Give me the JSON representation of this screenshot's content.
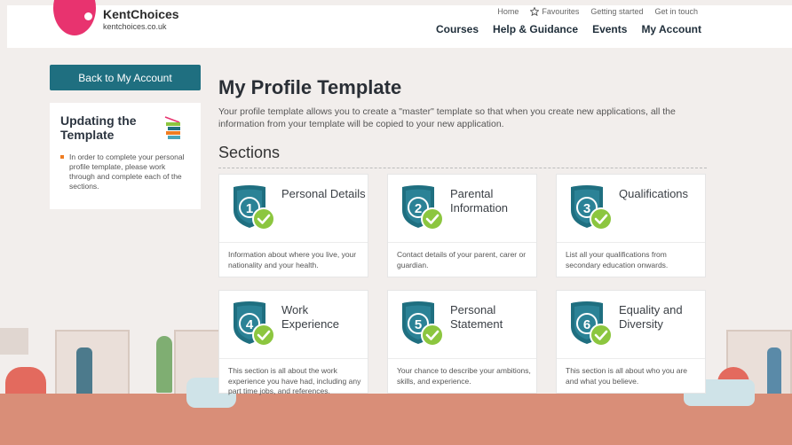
{
  "header": {
    "logo_name": "KentChoices",
    "logo_url": "kentchoices.co.uk",
    "top_links": [
      "Home",
      "Favourites",
      "Getting started",
      "Get in touch"
    ],
    "main_nav": [
      "Courses",
      "Help & Guidance",
      "Events",
      "My Account"
    ]
  },
  "sidebar": {
    "back_label": "Back to My Account",
    "card_title": "Updating the Template",
    "card_text": "In order to complete your personal profile template, please work through and complete each of the sections."
  },
  "main": {
    "title": "My Profile Template",
    "intro": "Your profile template allows you to create a \"master\" template so that when you create new applications, all the information from your template will be copied to your new application.",
    "sections_heading": "Sections"
  },
  "sections": [
    {
      "number": "1",
      "title": "Personal Details",
      "description": "Information about where you live, your nationality and your health."
    },
    {
      "number": "2",
      "title": "Parental Information",
      "description": "Contact details of your parent, carer or guardian."
    },
    {
      "number": "3",
      "title": "Qualifications",
      "description": "List all your qualifications from secondary education onwards."
    },
    {
      "number": "4",
      "title": "Work Experience",
      "description": "This section is all about the work experience you have had, including any part time jobs, and references."
    },
    {
      "number": "5",
      "title": "Personal Statement",
      "description": "Your chance to describe your ambitions, skills, and experience."
    },
    {
      "number": "6",
      "title": "Equality and Diversity",
      "description": "This section is all about who you are and what you believe."
    }
  ],
  "colors": {
    "brand_pink": "#e8336f",
    "teal": "#1f6f80",
    "check_green": "#8cc63f",
    "bullet_orange": "#ef7d22"
  }
}
